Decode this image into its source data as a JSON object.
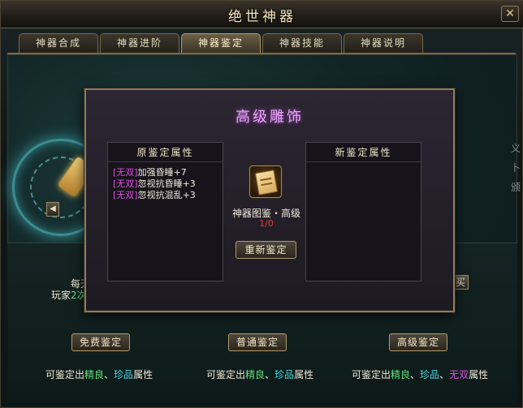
{
  "window": {
    "title": "绝世神器",
    "close_label": "✕"
  },
  "tabs": [
    {
      "label": "神器合成",
      "active": false
    },
    {
      "label": "神器进阶",
      "active": false
    },
    {
      "label": "神器鉴定",
      "active": true
    },
    {
      "label": "神器技能",
      "active": false
    },
    {
      "label": "神器说明",
      "active": false
    }
  ],
  "background": {
    "daily_line1": "每天",
    "daily_line2_prefix": "玩家",
    "daily_line2_hl": "2次",
    "right_btn_fragment": "买",
    "side_text": "义卜\n颁",
    "buttons": [
      {
        "label": "免费鉴定"
      },
      {
        "label": "普通鉴定"
      },
      {
        "label": "高级鉴定"
      }
    ],
    "hints": [
      {
        "prefix": "可鉴定出",
        "q1": "精良",
        "sep1": "、",
        "q2": "珍品",
        "suffix": "属性"
      },
      {
        "prefix": "可鉴定出",
        "q1": "精良",
        "sep1": "、",
        "q2": "珍品",
        "suffix": "属性"
      },
      {
        "prefix": "可鉴定出",
        "q1": "精良",
        "sep1": "、",
        "q2": "珍品",
        "sep2": "、",
        "q3": "无双",
        "suffix": "属性"
      }
    ],
    "arrow_label": "◀"
  },
  "modal": {
    "title": "高级雕饰",
    "original_header": "原鉴定属性",
    "new_header": "新鉴定属性",
    "original_attrs": [
      {
        "tag": "[无双]",
        "text": "加强昏睡+7"
      },
      {
        "tag": "[无双]",
        "text": "忽视抗昏睡+3"
      },
      {
        "tag": "[无双]",
        "text": "忽视抗混乱+3"
      }
    ],
    "item_name": "神器图鉴・高级",
    "item_count": "1/0",
    "reidentify_label": "重新鉴定"
  },
  "colors": {
    "quality_good": "#5fe07a",
    "quality_rare": "#40d8e0",
    "quality_peerless": "#e050e0",
    "title_glow": "#e9a8f5",
    "count_red": "#e23c2c"
  }
}
